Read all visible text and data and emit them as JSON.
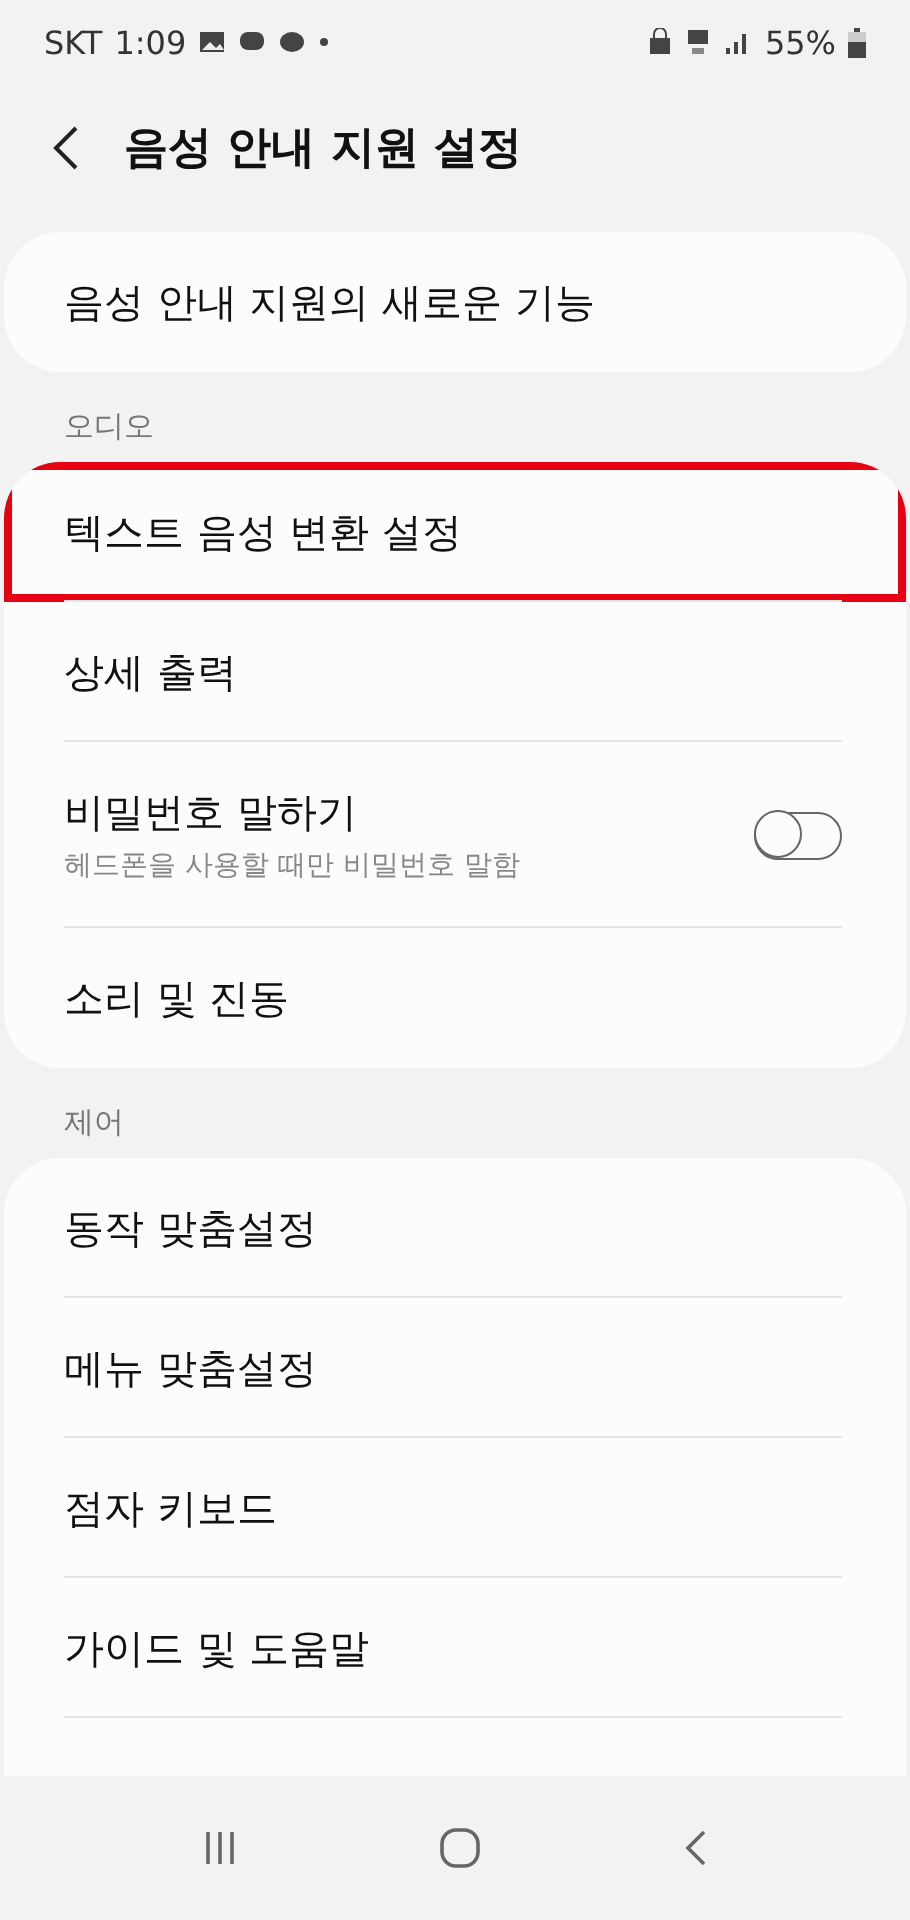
{
  "status_bar": {
    "carrier": "SKT",
    "time": "1:09",
    "battery": "55%"
  },
  "header": {
    "title": "음성 안내 지원 설정"
  },
  "groups": [
    {
      "items": [
        {
          "kind": "link",
          "title": "음성 안내 지원의 새로운 기능",
          "highlighted": false
        }
      ]
    },
    {
      "heading": "오디오",
      "items": [
        {
          "kind": "link",
          "title": "텍스트 음성 변환 설정",
          "highlighted": true
        },
        {
          "kind": "link",
          "title": "상세 출력",
          "highlighted": false
        },
        {
          "kind": "switch",
          "title": "비밀번호 말하기",
          "subtitle": "헤드폰을 사용할 때만 비밀번호 말함",
          "on": false,
          "highlighted": false
        },
        {
          "kind": "link",
          "title": "소리 및 진동",
          "highlighted": false
        }
      ]
    },
    {
      "heading": "제어",
      "items": [
        {
          "kind": "link",
          "title": "동작 맞춤설정",
          "highlighted": false
        },
        {
          "kind": "link",
          "title": "메뉴 맞춤설정",
          "highlighted": false
        },
        {
          "kind": "link",
          "title": "점자 키보드",
          "highlighted": false
        },
        {
          "kind": "link",
          "title": "가이드 및 도움말",
          "highlighted": false
        }
      ]
    }
  ]
}
